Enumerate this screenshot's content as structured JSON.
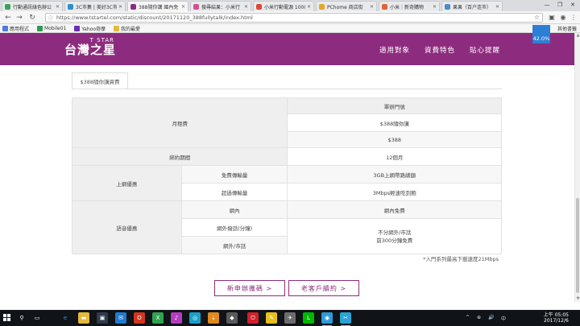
{
  "browser": {
    "tabs": [
      {
        "label": "行動通訊綠色辦公",
        "color": "#3aa35b",
        "active": false
      },
      {
        "label": "3C市集 | 美好3C市",
        "color": "#2b8ed1",
        "active": false
      },
      {
        "label": "388隨你講 國內免",
        "color": "#8d2c7e",
        "active": true
      },
      {
        "label": "搜尋結果：小米行",
        "color": "#d24f8d",
        "active": false
      },
      {
        "label": "小米行動電源 10000",
        "color": "#e0453b",
        "active": false
      },
      {
        "label": "PChome 商店街",
        "color": "#e2a52a",
        "active": false
      },
      {
        "label": "小米｜新奇購物",
        "color": "#e0643b",
        "active": false
      },
      {
        "label": "果果（百户连市）",
        "color": "#4a8cca",
        "active": false
      }
    ],
    "window_controls": [
      "—",
      "❐",
      "✕"
    ],
    "url": "https://www.tstartel.com/static/discount/20171120_388fullytalk/index.html",
    "extension_badge": "42.0%",
    "bookmarks": [
      {
        "label": "應用程式",
        "color": "#4a7be0"
      },
      {
        "label": "Mobile01",
        "color": "#2e9c4e"
      },
      {
        "label": "Yahoo奇摩",
        "color": "#6b2fb3"
      },
      {
        "label": "我的最愛",
        "color": "#e6b93c"
      }
    ],
    "other_bookmarks": "其他書籤"
  },
  "site": {
    "logo_small": "T STAR",
    "logo_big": "台灣之星",
    "nav": [
      "適用對象",
      "資費特色",
      "貼心提醒"
    ]
  },
  "plan": {
    "tab_label": "$388隨你講資費",
    "rows": {
      "header": "單辦門號",
      "monthly_fee_label": "月租費",
      "monthly_fee_name": "$388隨你講",
      "monthly_fee_price": "$388",
      "contract_label": "綁約期間",
      "contract_value": "12個月",
      "internet_label": "上網優惠",
      "free_data_label": "免費傳輸量",
      "free_data_value": "3GB上網帶路總額",
      "excess_data_label": "超過傳輸量",
      "excess_data_value": "3Mbps輕速吃到飽",
      "voice_label": "語音優惠",
      "on_net_label": "網內",
      "on_net_value": "網內免費",
      "off_net_label": "網外撥話(分鐘)",
      "landline_label": "網外/市話",
      "off_net_value_line1": "不分網外/市話",
      "off_net_value_line2": "前300分鐘免費"
    },
    "footnote": "*入門系列最高下載速度21Mbps"
  },
  "cta": {
    "new_applicant": "新申辦攜碼 >",
    "existing_customer": "老客戶續約 >"
  },
  "taskbar": {
    "clock_time": "上午 05:05",
    "clock_date": "2017/12/6",
    "tray": [
      "^",
      "⊕",
      "🔊",
      "中"
    ]
  }
}
